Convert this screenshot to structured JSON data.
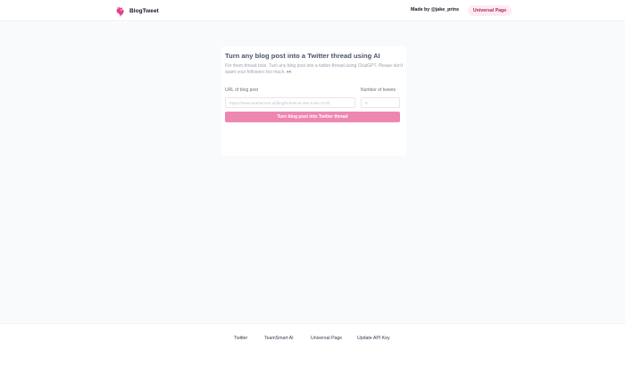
{
  "header": {
    "brand_name": "BlogTweet",
    "made_by": "Made by @jake_prins",
    "cta_label": "Universal Page"
  },
  "form": {
    "title": "Turn any blog post into a Twitter thread using AI",
    "description": "For them thread bois. Turn any blog post into a twitter thread using ChatGPT. Please don't spam your followers too much. 👀",
    "url_label": "URL of blog post",
    "url_placeholder": "https://www.teamsmart.ai/blog/5-best-ai-dev-tools-of-20",
    "count_label": "Number of tweets",
    "count_placeholder": "8",
    "submit_label": "Turn blog post into Twitter thread"
  },
  "footer": {
    "links": [
      "Twitter",
      "TeamSmart AI",
      "Universal Page",
      "Update API Key"
    ]
  },
  "colors": {
    "accent": "#ee86b2",
    "pill_bg": "#fdecf3",
    "pill_text": "#b3265e",
    "logo": "#e0448a",
    "page_bg": "#f9fafb"
  },
  "icons": {
    "brand_logo": "pink-bird-icon"
  }
}
